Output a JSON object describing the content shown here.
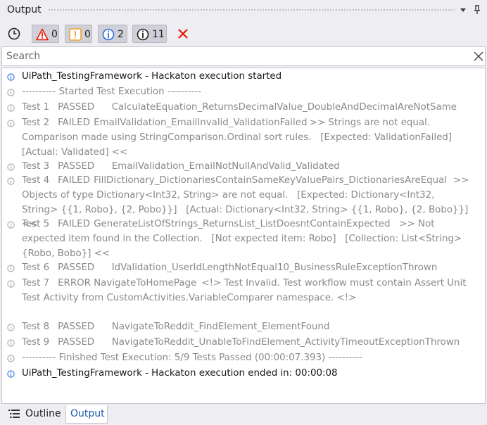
{
  "panel": {
    "title": "Output",
    "menu_icon": "dropdown-arrow-icon",
    "pin_icon": "pin-icon"
  },
  "toolbar": {
    "timestamp_icon": "clock-icon",
    "errors": {
      "icon": "error-triangle-icon",
      "count": "0",
      "color": "#e51400"
    },
    "warnings": {
      "icon": "warning-icon",
      "count": "0",
      "color": "#f0a030"
    },
    "info": {
      "icon": "info-icon",
      "count": "2",
      "color": "#2b6fd6"
    },
    "trace": {
      "icon": "trace-info-icon",
      "count": "11",
      "color": "#1e1e1e"
    },
    "clear_icon": "clear-x-icon",
    "clear_color": "#e51400"
  },
  "search": {
    "placeholder": "Search",
    "value": ""
  },
  "log": [
    {
      "level": "info",
      "text": "UiPath_TestingFramework - Hackaton execution started"
    },
    {
      "level": "trace",
      "text": "---------- Started Test Execution ----------"
    },
    {
      "level": "trace",
      "text": "Test 1\tPASSED\tCalculateEquation_ReturnsDecimalValue_DoubleAndDecimalAreNotSame"
    },
    {
      "level": "trace",
      "text": "Test 2\tFAILED\tEmailValidation_EmailInvalid_ValidationFailed\t>> Strings are not equal. Comparison made using StringComparison.Ordinal sort rules.   [Expected: ValidationFailed]   [Actual: Validated] <<"
    },
    {
      "level": "trace",
      "text": "Test 3\tPASSED\tEmailValidation_EmailNotNullAndValid_Validated"
    },
    {
      "level": "trace",
      "text": "Test 4\tFAILED\tFillDictionary_DictionariesContainSameKeyValuePairs_DictionariesAreEqual\t>> Objects of type Dictionary<Int32, String> are not equal.   [Expected: Dictionary<Int32, String> {{1, Robo}, {2, Pobo}}]   [Actual: Dictionary<Int32, String> {{1, Robo}, {2, Bobo}}] <<"
    },
    {
      "level": "trace",
      "text": "Test 5\tFAILED\tGenerateListOfStrings_ReturnsList_ListDoesntContainExpected\t>> Not expected item found in the Collection.   [Not expected item: Robo]   [Collection: List<String> {Robo, Bobo}] <<"
    },
    {
      "level": "trace",
      "text": "Test 6\tPASSED\tIdValidation_UserIdLengthNotEqual10_BusinessRuleExceptionThrown"
    },
    {
      "level": "trace",
      "text": "Test 7\tERROR\tNavigateToHomePage\t<!> Test Invalid. Test workflow must contain Assert Unit Test Activity from CustomActivities.VariableComparer namespace. <!>"
    },
    {
      "level": "trace",
      "text": "Test 8\tPASSED\tNavigateToReddit_FindElement_ElementFound"
    },
    {
      "level": "trace",
      "text": "Test 9\tPASSED\tNavigateToReddit_UnableToFindElement_ActivityTimeoutExceptionThrown"
    },
    {
      "level": "trace",
      "text": "---------- Finished Test Execution: 5/9 Tests Passed (00:00:07.393) ----------"
    },
    {
      "level": "info",
      "text": "UiPath_TestingFramework - Hackaton execution ended in: 00:00:08"
    }
  ],
  "tabs": [
    {
      "label": "Outline",
      "icon": "outline-list-icon",
      "active": false
    },
    {
      "label": "Output",
      "active": true
    }
  ]
}
